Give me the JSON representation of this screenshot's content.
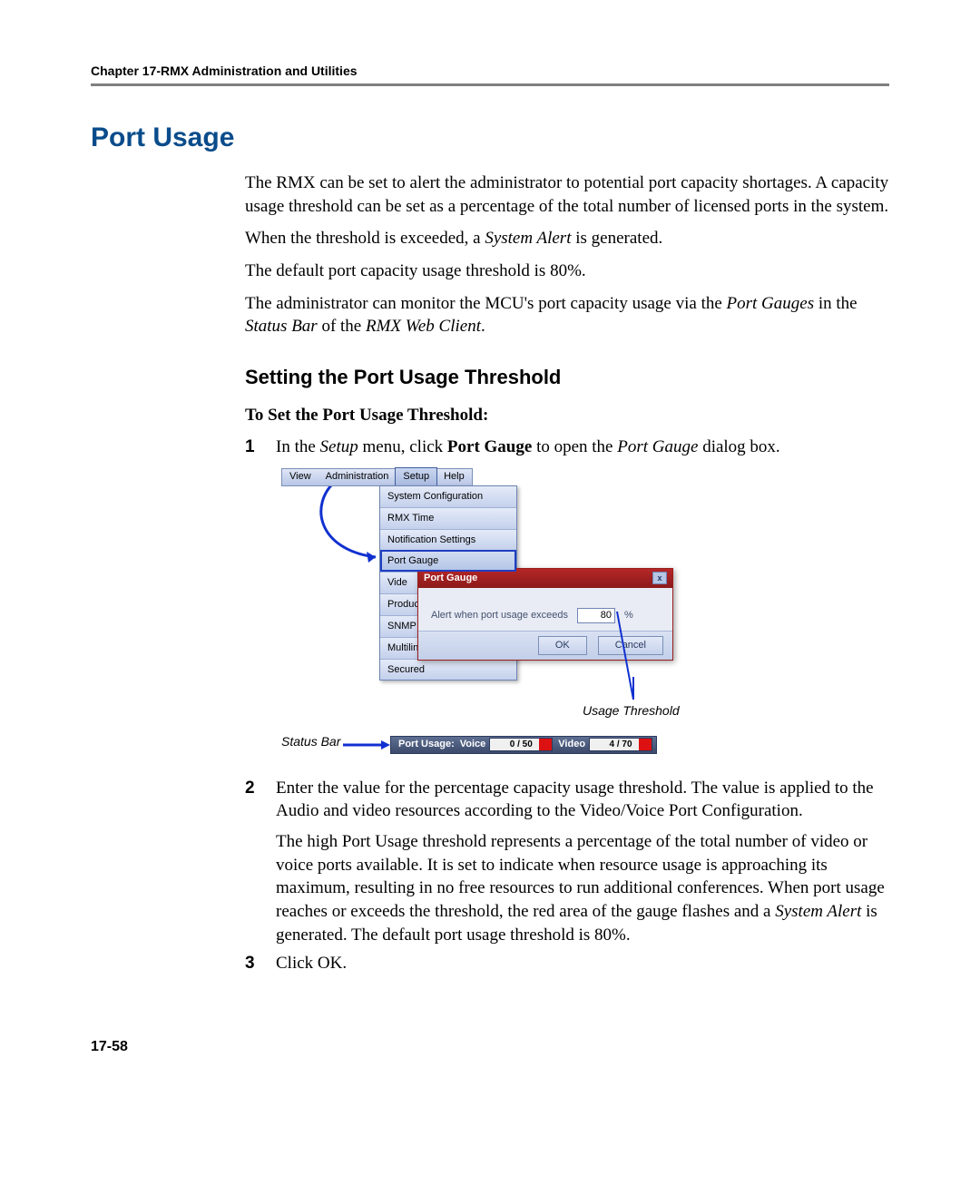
{
  "header": {
    "chapter_line": "Chapter 17-RMX Administration and Utilities"
  },
  "headings": {
    "h1": "Port Usage",
    "h2": "Setting the Port Usage Threshold",
    "sub": "To Set the Port Usage Threshold:"
  },
  "paragraphs": {
    "p1": "The RMX can be set to alert the administrator to potential port capacity shortages. A capacity usage threshold can be set as a percentage of the total number of licensed ports in the system.",
    "p2_a": "When the threshold is exceeded, a ",
    "p2_b": "System Alert",
    "p2_c": " is generated.",
    "p3": "The default port capacity usage threshold is 80%.",
    "p4_a": "The administrator can monitor the MCU's port capacity usage via the ",
    "p4_b": "Port Gauges",
    "p4_c": " in the ",
    "p4_d": "Status Bar",
    "p4_e": " of the ",
    "p4_f": "RMX Web Client",
    "p4_g": "."
  },
  "steps": {
    "n1": "1",
    "s1_a": "In the ",
    "s1_b": "Setup",
    "s1_c": " menu, click ",
    "s1_d": "Port Gauge",
    "s1_e": " to open the ",
    "s1_f": "Port Gauge",
    "s1_g": " dialog box.",
    "n2": "2",
    "s2_a": "Enter the value for the percentage capacity usage threshold. The value is applied to the Audio and video resources according to the Video/Voice Port Configuration.",
    "s2_b_a": "The high Port Usage threshold represents a percentage of the total number of video or voice ports available. It is set to indicate when resource usage is approaching its maximum, resulting in no free resources to run additional conferences. When port usage reaches or exceeds the threshold, the red area of the gauge flashes and a ",
    "s2_b_b": "System Alert",
    "s2_b_c": " is generated. The default port usage threshold is 80%.",
    "n3": "3",
    "s3": "Click OK."
  },
  "figure": {
    "menu": {
      "view": "View",
      "admin": "Administration",
      "setup": "Setup",
      "help": "Help"
    },
    "dropdown": {
      "i1": "System Configuration",
      "i2": "RMX Time",
      "i3": "Notification Settings",
      "i4": "Port Gauge",
      "i5": "Vide",
      "i6": "Product",
      "i7": "SNMP",
      "i8": "Multiling",
      "i9": "Secured"
    },
    "dialog": {
      "title": "Port Gauge",
      "close": "x",
      "label": "Alert when port usage exceeds",
      "value": "80",
      "pct": "%",
      "ok": "OK",
      "cancel": "Cancel"
    },
    "status": {
      "label": "Port Usage:",
      "voice_label": "Voice",
      "voice_value": "0 / 50",
      "video_label": "Video",
      "video_value": "4 / 70"
    },
    "annotations": {
      "usage_threshold": "Usage Threshold",
      "status_bar": "Status Bar"
    }
  },
  "footer": {
    "page_number": "17-58"
  }
}
